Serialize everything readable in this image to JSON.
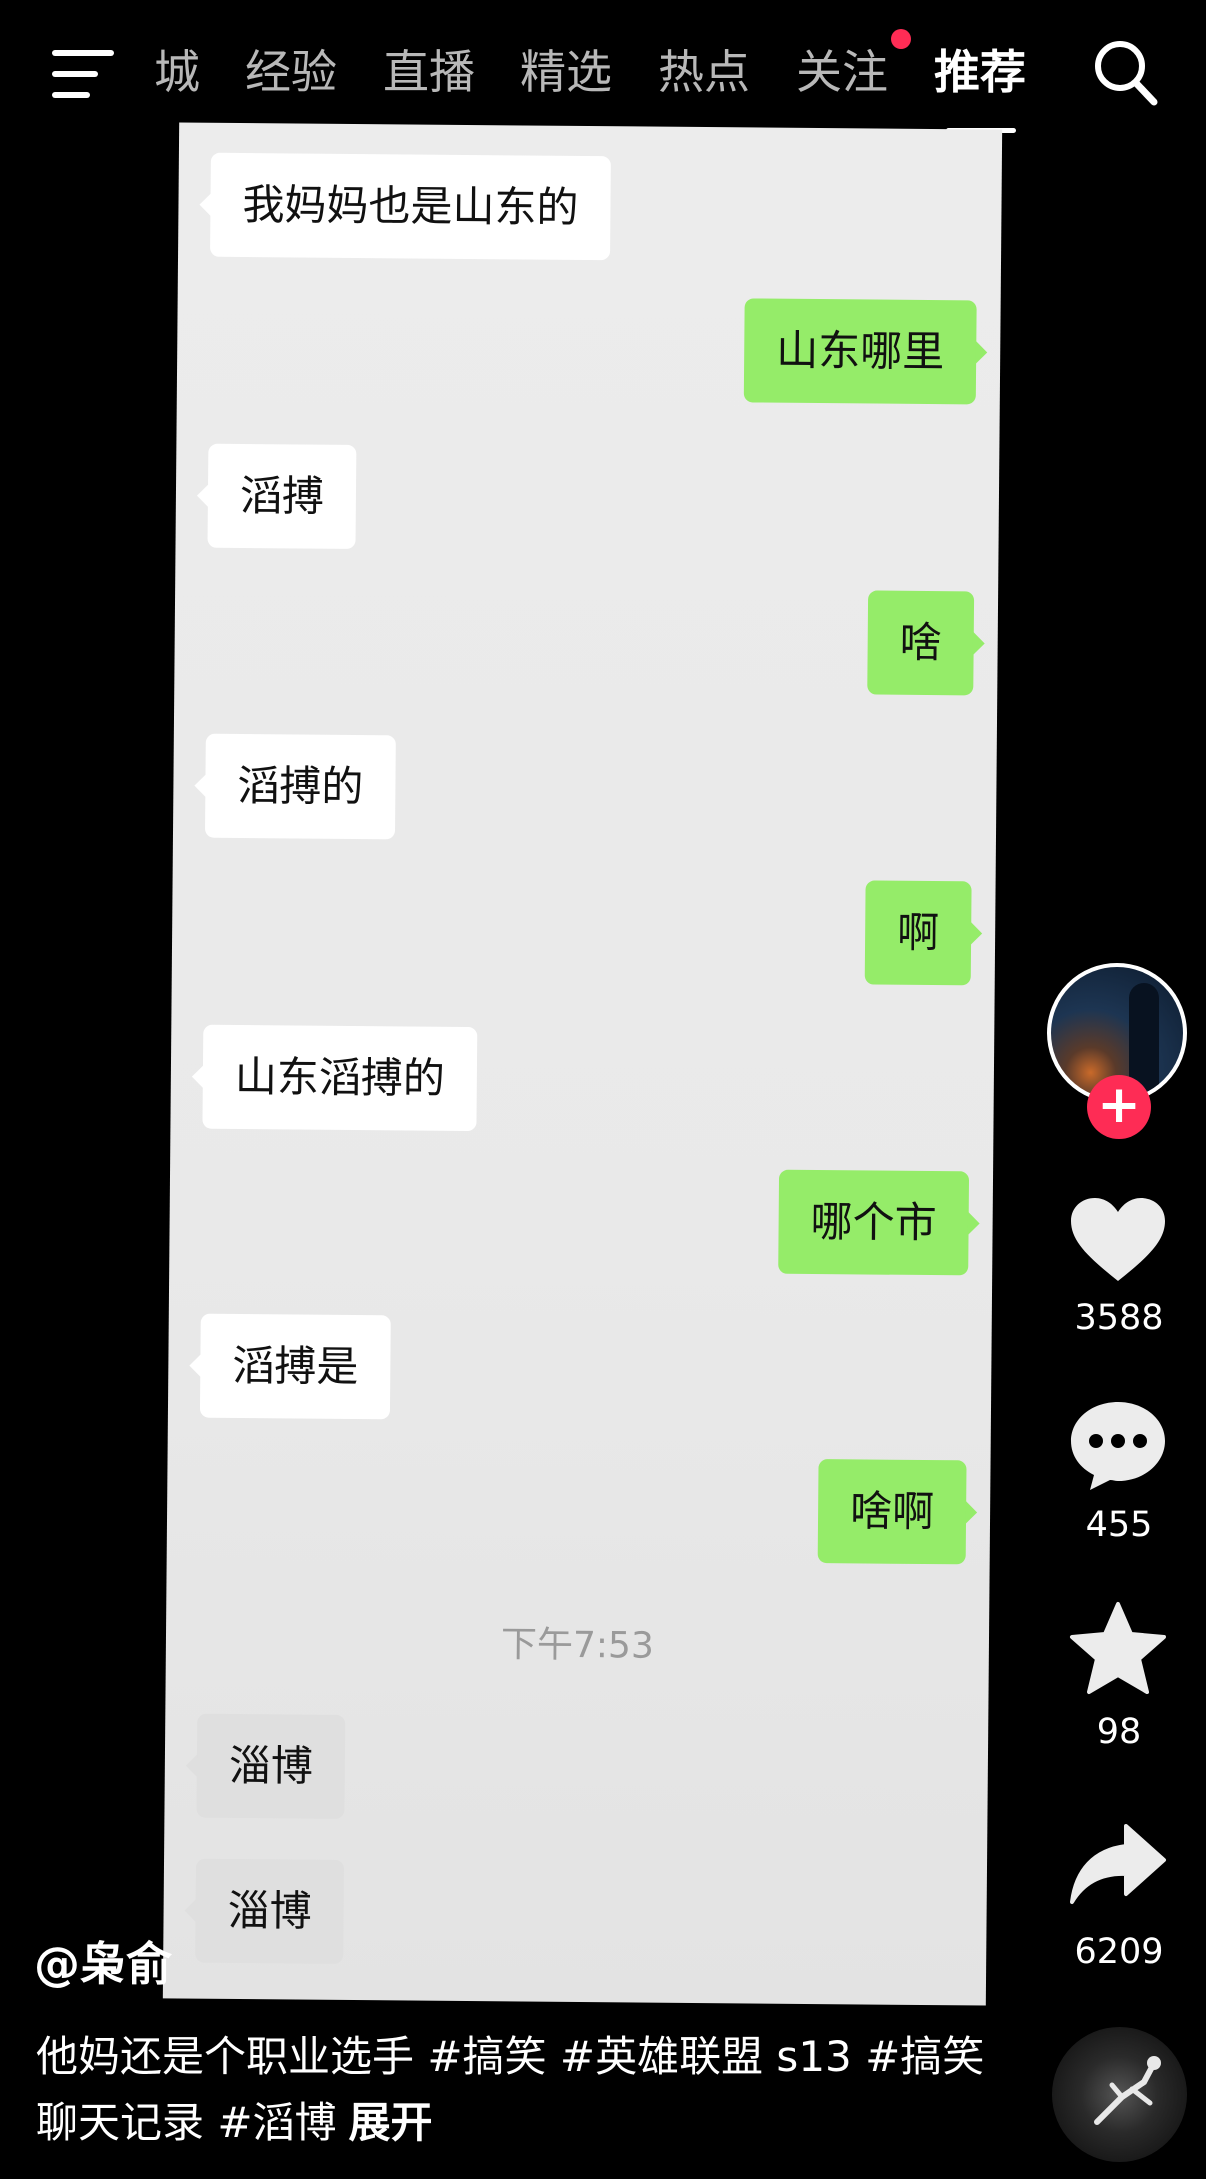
{
  "nav": {
    "tabs": [
      "城",
      "经验",
      "直播",
      "精选",
      "热点",
      "关注",
      "推荐"
    ],
    "active_tab": "推荐"
  },
  "chat": {
    "messages": [
      {
        "side": "in",
        "text": "我妈妈也是山东的"
      },
      {
        "side": "out",
        "text": "山东哪里"
      },
      {
        "side": "in",
        "text": "滔搏"
      },
      {
        "side": "out",
        "text": "啥"
      },
      {
        "side": "in",
        "text": "滔搏的"
      },
      {
        "side": "out",
        "text": "啊"
      },
      {
        "side": "in",
        "text": "山东滔搏的"
      },
      {
        "side": "out",
        "text": "哪个市"
      },
      {
        "side": "in",
        "text": "滔搏是"
      },
      {
        "side": "out",
        "text": "啥啊"
      },
      {
        "side": "in",
        "text": "淄博"
      },
      {
        "side": "in",
        "text": "淄博"
      }
    ],
    "time": "下午7:53"
  },
  "actions": {
    "likes": "3588",
    "comments": "455",
    "favorites": "98",
    "shares": "6209",
    "follow_symbol": "+"
  },
  "video": {
    "author": "@枭俞",
    "caption": "他妈还是个职业选手 #搞笑 #英雄联盟 s13 #搞笑聊天记录 #滔博",
    "expand_label": "展开"
  },
  "colors": {
    "background": "#000000",
    "incoming_bubble": "#ffffff",
    "outgoing_bubble": "#95ec69",
    "notification_dot": "#fe2c55",
    "follow_button": "#fe2c55"
  },
  "icons": [
    "menu-icon",
    "search-icon",
    "heart-icon",
    "comment-icon",
    "star-icon",
    "share-icon"
  ]
}
